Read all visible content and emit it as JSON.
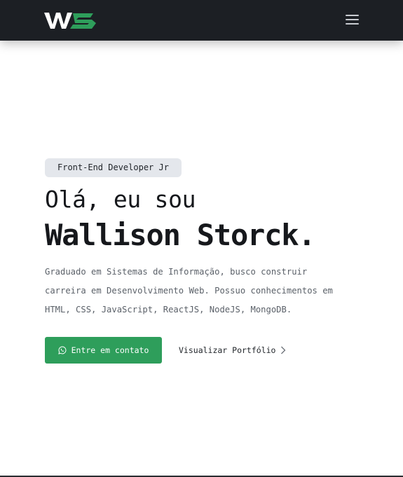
{
  "header": {
    "logo_text": "WS",
    "menu_icon": "hamburger-menu-icon",
    "colors": {
      "background": "#1c1f24",
      "logo_white": "#ffffff",
      "logo_green": "#2e9e5b"
    }
  },
  "hero": {
    "badge": "Front-End Developer Jr",
    "greeting": "Olá, eu sou",
    "name": "Wallison Storck.",
    "description": "Graduado em Sistemas de Informação, busco construir carreira em Desenvolvimento Web. Possuo conhecimentos em HTML, CSS, JavaScript, ReactJS, NodeJS, MongoDB.",
    "contact_button": {
      "label": "Entre em contato",
      "icon": "whatsapp-icon",
      "color": "#2e9e5b"
    },
    "portfolio_link": {
      "label": "Visualizar Portfólio",
      "icon": "chevron-right-icon"
    }
  }
}
